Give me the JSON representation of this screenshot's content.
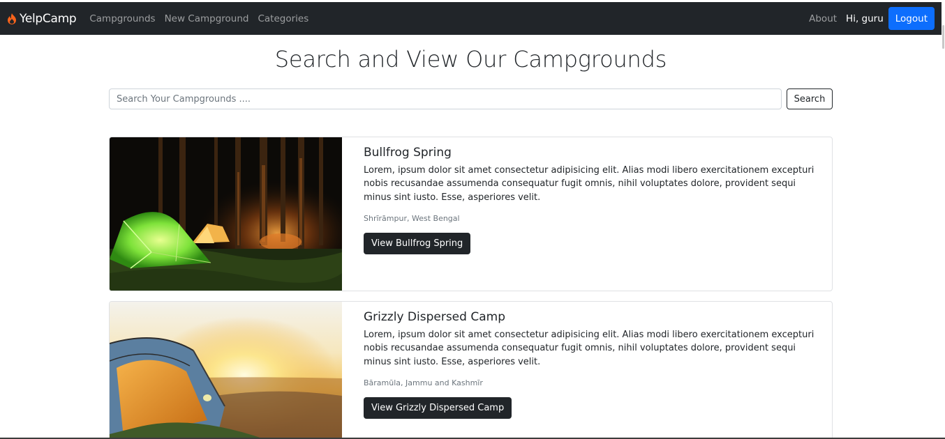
{
  "navbar": {
    "brand": "YelpCamp",
    "links": [
      "Campgrounds",
      "New Campground",
      "Categories"
    ],
    "about": "About",
    "greeting": "Hi, guru",
    "logout_label": "Logout"
  },
  "main": {
    "title": "Search and View Our Campgrounds",
    "search": {
      "placeholder": "Search Your Campgrounds ....",
      "value": "",
      "button_label": "Search"
    }
  },
  "campgrounds": [
    {
      "title": "Bullfrog Spring",
      "description": "Lorem, ipsum dolor sit amet consectetur adipisicing elit. Alias modi libero exercitationem excepturi nobis recusandae assumenda consequatur fugit omnis, nihil voluptates dolore, provident sequi minus sint iusto. Esse, asperiores velit.",
      "location": "Shrīrāmpur, West Bengal",
      "button_label": "View Bullfrog Spring"
    },
    {
      "title": "Grizzly Dispersed Camp",
      "description": "Lorem, ipsum dolor sit amet consectetur adipisicing elit. Alias modi libero exercitationem excepturi nobis recusandae assumenda consequatur fugit omnis, nihil voluptates dolore, provident sequi minus sint iusto. Esse, asperiores velit.",
      "location": "Bāramūla, Jammu and Kashmīr",
      "button_label": "View Grizzly Dispersed Camp"
    }
  ],
  "colors": {
    "navbar": "#212529",
    "primary": "#0d6efd",
    "brand_flame": "#f7631b"
  },
  "icons": {
    "brand": "fire-icon"
  }
}
